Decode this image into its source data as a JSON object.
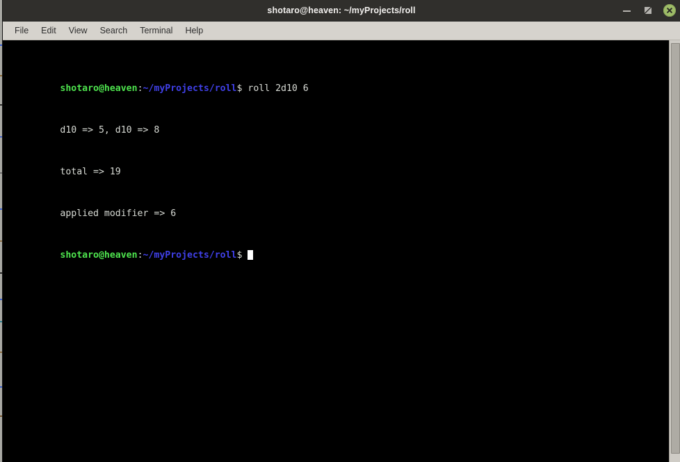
{
  "window": {
    "title": "shotaro@heaven: ~/myProjects/roll",
    "controls": {
      "minimize_label": "–",
      "maximize_label": "▫",
      "close_label": "✕"
    }
  },
  "menubar": {
    "items": [
      {
        "label": "File"
      },
      {
        "label": "Edit"
      },
      {
        "label": "View"
      },
      {
        "label": "Search"
      },
      {
        "label": "Terminal"
      },
      {
        "label": "Help"
      }
    ]
  },
  "terminal": {
    "colors": {
      "background": "#000000",
      "foreground": "#d3d7cf",
      "user_host": "#4ee44e",
      "path": "#4040e8",
      "cursor": "#ffffff"
    },
    "lines": [
      {
        "type": "prompt-command",
        "user_host": "shotaro@heaven",
        "separator": ":",
        "path": "~/myProjects/roll",
        "sigil": "$",
        "command": " roll 2d10 6"
      },
      {
        "type": "output",
        "text": "d10 => 5, d10 => 8"
      },
      {
        "type": "output",
        "text": "total => 19"
      },
      {
        "type": "output",
        "text": "applied modifier => 6"
      },
      {
        "type": "prompt-cursor",
        "user_host": "shotaro@heaven",
        "separator": ":",
        "path": "~/myProjects/roll",
        "sigil": "$",
        "command": " "
      }
    ]
  },
  "scrollbar": {
    "orientation": "vertical",
    "thumb_position": "full"
  }
}
